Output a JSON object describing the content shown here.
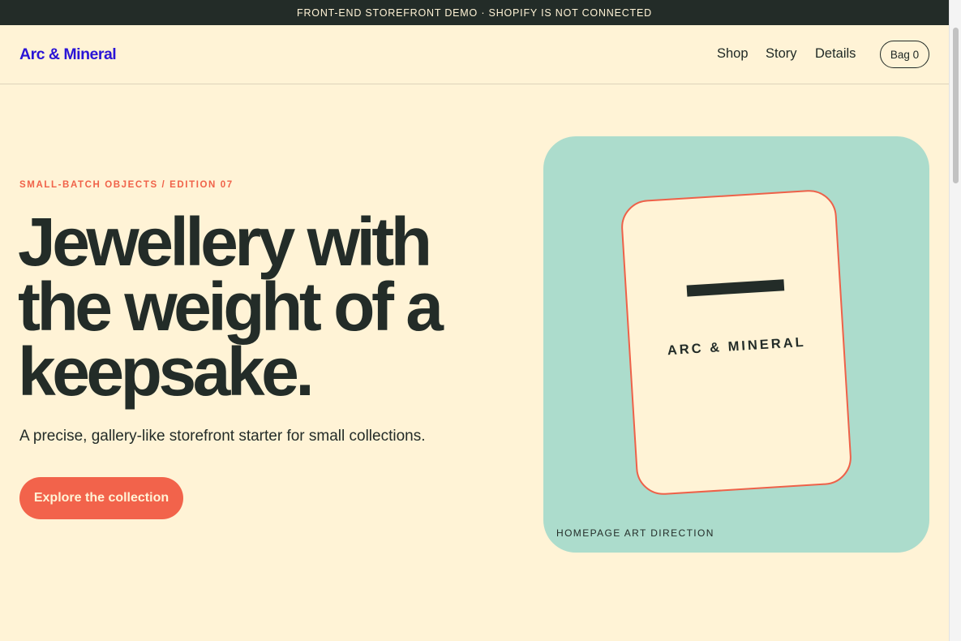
{
  "announcement": "FRONT-END STOREFRONT DEMO · SHOPIFY IS NOT CONNECTED",
  "header": {
    "logo": "Arc & Mineral",
    "nav": [
      "Shop",
      "Story",
      "Details"
    ],
    "bag_label": "Bag 0"
  },
  "hero": {
    "eyebrow": "SMALL-BATCH OBJECTS / EDITION 07",
    "headline_lines": [
      "Jewellery with",
      "the weight of a",
      "keepsake."
    ],
    "subhead": "A precise, gallery-like storefront starter for small collections.",
    "cta_label": "Explore the collection"
  },
  "art": {
    "card_label": "ARC & MINERAL",
    "caption": "HOMEPAGE ART DIRECTION"
  },
  "colors": {
    "background": "#fff3d6",
    "announcement_bg": "#232c28",
    "logo": "#2a14d6",
    "accent": "#f2634b",
    "art_panel": "#acdccc",
    "text": "#232c28"
  }
}
